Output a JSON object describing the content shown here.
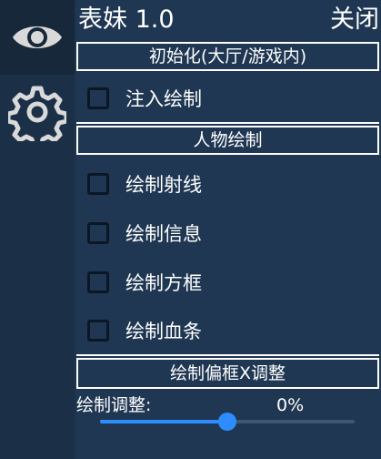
{
  "sidebar": {
    "tabs": [
      {
        "icon": "eye-icon",
        "active": true
      },
      {
        "icon": "gear-icon",
        "active": false
      }
    ]
  },
  "header": {
    "title": "表妹 1.0",
    "close_label": "关闭"
  },
  "sections": {
    "init": "初始化(大厅/游戏内)",
    "character": "人物绘制",
    "offset": "绘制偏框X调整"
  },
  "checkboxes": {
    "inject": {
      "label": "注入绘制",
      "checked": false
    },
    "ray": {
      "label": "绘制射线",
      "checked": false
    },
    "info": {
      "label": "绘制信息",
      "checked": false
    },
    "box": {
      "label": "绘制方框",
      "checked": false
    },
    "health": {
      "label": "绘制血条",
      "checked": false
    }
  },
  "adjust": {
    "label": "绘制调整:",
    "value_text": "0%",
    "value": 0.5
  },
  "colors": {
    "accent": "#2f8cff",
    "panel": "#1f3752",
    "sidebar": "#1b3047"
  }
}
